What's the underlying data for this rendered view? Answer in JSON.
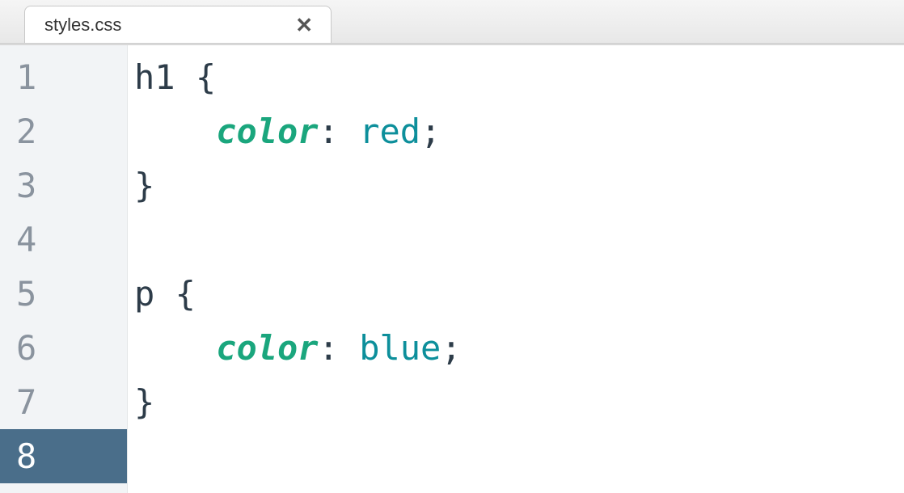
{
  "tab": {
    "filename": "styles.css"
  },
  "editor": {
    "active_line": 8,
    "lines": [
      {
        "n": "1",
        "tokens": [
          {
            "text": "h1",
            "cls": "tok-selector"
          },
          {
            "text": " ",
            "cls": "tok-space"
          },
          {
            "text": "{",
            "cls": "tok-brace"
          }
        ]
      },
      {
        "n": "2",
        "tokens": [
          {
            "text": "    ",
            "cls": "tok-space"
          },
          {
            "text": "color",
            "cls": "tok-property"
          },
          {
            "text": ":",
            "cls": "tok-colon"
          },
          {
            "text": " ",
            "cls": "tok-space"
          },
          {
            "text": "red",
            "cls": "tok-value"
          },
          {
            "text": ";",
            "cls": "tok-semicolon"
          }
        ]
      },
      {
        "n": "3",
        "tokens": [
          {
            "text": "}",
            "cls": "tok-brace"
          }
        ]
      },
      {
        "n": "4",
        "tokens": []
      },
      {
        "n": "5",
        "tokens": [
          {
            "text": "p",
            "cls": "tok-selector"
          },
          {
            "text": " ",
            "cls": "tok-space"
          },
          {
            "text": "{",
            "cls": "tok-brace"
          }
        ]
      },
      {
        "n": "6",
        "tokens": [
          {
            "text": "    ",
            "cls": "tok-space"
          },
          {
            "text": "color",
            "cls": "tok-property"
          },
          {
            "text": ":",
            "cls": "tok-colon"
          },
          {
            "text": " ",
            "cls": "tok-space"
          },
          {
            "text": "blue",
            "cls": "tok-value"
          },
          {
            "text": ";",
            "cls": "tok-semicolon"
          }
        ]
      },
      {
        "n": "7",
        "tokens": [
          {
            "text": "}",
            "cls": "tok-brace"
          }
        ]
      },
      {
        "n": "8",
        "tokens": []
      }
    ]
  }
}
